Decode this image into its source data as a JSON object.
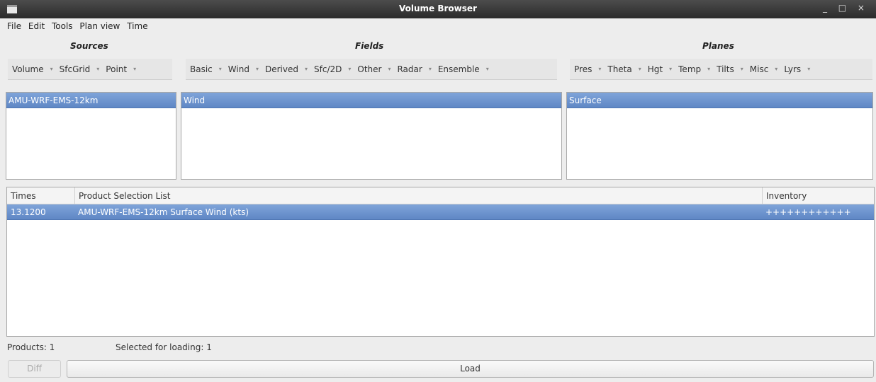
{
  "window": {
    "title": "Volume Browser",
    "controls": "_ □ ×"
  },
  "menu": [
    "File",
    "Edit",
    "Tools",
    "Plan view",
    "Time"
  ],
  "groups": {
    "sources": {
      "label": "Sources",
      "dropdowns": [
        "Volume",
        "SfcGrid",
        "Point"
      ]
    },
    "fields": {
      "label": "Fields",
      "dropdowns": [
        "Basic",
        "Wind",
        "Derived",
        "Sfc/2D",
        "Other",
        "Radar",
        "Ensemble"
      ]
    },
    "planes": {
      "label": "Planes",
      "dropdowns": [
        "Pres",
        "Theta",
        "Hgt",
        "Temp",
        "Tilts",
        "Misc",
        "Lyrs"
      ]
    }
  },
  "lists": {
    "sources_selected": "AMU-WRF-EMS-12km",
    "fields_selected": "Wind",
    "planes_selected": "Surface"
  },
  "product_table": {
    "headers": {
      "times": "Times",
      "product": "Product Selection List",
      "inventory": "Inventory"
    },
    "rows": [
      {
        "time": "13.1200",
        "product": "AMU-WRF-EMS-12km Surface Wind (kts)",
        "inventory": "++++++++++++"
      }
    ]
  },
  "status": {
    "products": "Products: 1",
    "selected": "Selected for loading: 1"
  },
  "buttons": {
    "diff": "Diff",
    "load": "Load"
  },
  "colors": {
    "selection": "#6b92cf",
    "titlebar": "#3a3a3a"
  }
}
